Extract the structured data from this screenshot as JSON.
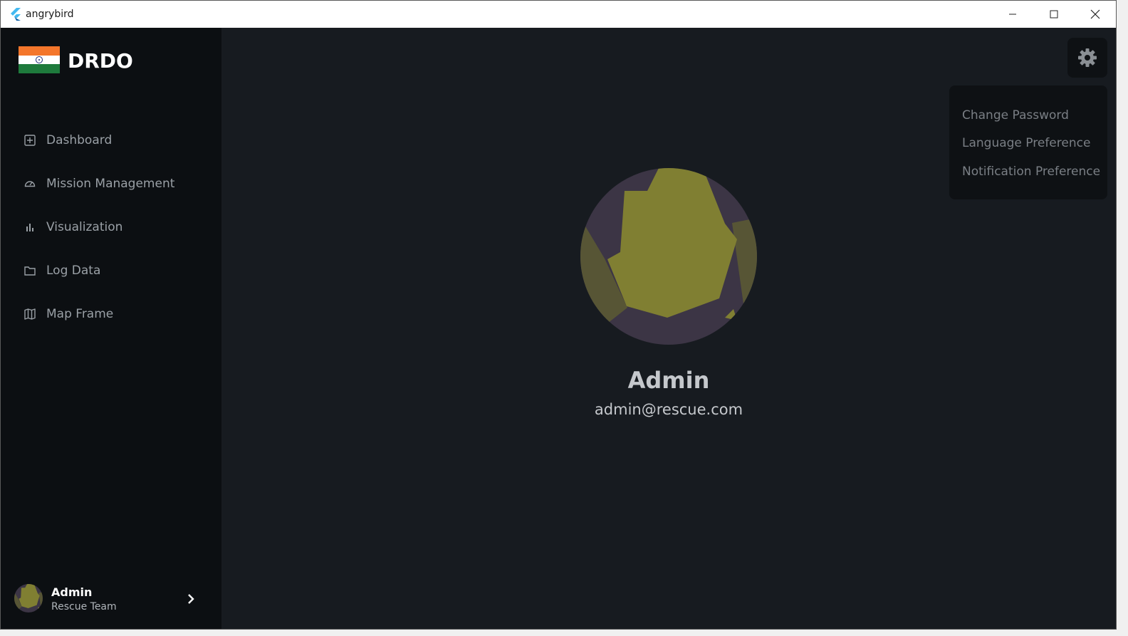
{
  "window": {
    "title": "angrybird"
  },
  "sidebar": {
    "brand": "DRDO",
    "items": [
      {
        "label": "Dashboard",
        "icon": "dashboard-icon"
      },
      {
        "label": "Mission Management",
        "icon": "gauge-icon"
      },
      {
        "label": "Visualization",
        "icon": "bar-chart-icon"
      },
      {
        "label": "Log Data",
        "icon": "folder-icon"
      },
      {
        "label": "Map Frame",
        "icon": "map-icon"
      }
    ],
    "user": {
      "name": "Admin",
      "role": "Rescue Team"
    }
  },
  "settings_menu": {
    "items": [
      "Change Password",
      "Language Preference",
      "Notification Preference"
    ]
  },
  "profile": {
    "name": "Admin",
    "email": "admin@rescue.com"
  },
  "colors": {
    "background": "#171b20",
    "sidebar": "#0c0f12",
    "avatar_olive": "#807f32",
    "avatar_dark": "#3c3545"
  }
}
